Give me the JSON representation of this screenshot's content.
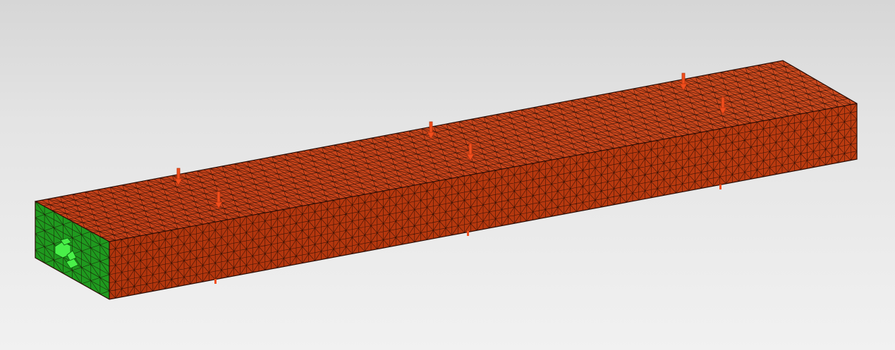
{
  "viewer": {
    "background_top": "#d6d6d6",
    "background_bottom": "#f1f1f1"
  },
  "model": {
    "type": "meshed-beam",
    "mesh_element": "triangle",
    "body_color": "#c43d12",
    "top_face_color": "#c8431a",
    "side_face_color": "#b7380f",
    "end_face_color": "#1f9a1f",
    "mesh_line_color": "#1a0a05",
    "constraint_color": "#49f049",
    "load_color": "#f24f1e"
  },
  "loads": {
    "count": 6,
    "direction": "down",
    "icon": "arrow-down-icon"
  },
  "constraints": {
    "count": 1,
    "location": "left end face",
    "icon": "fixed-support-icon"
  }
}
